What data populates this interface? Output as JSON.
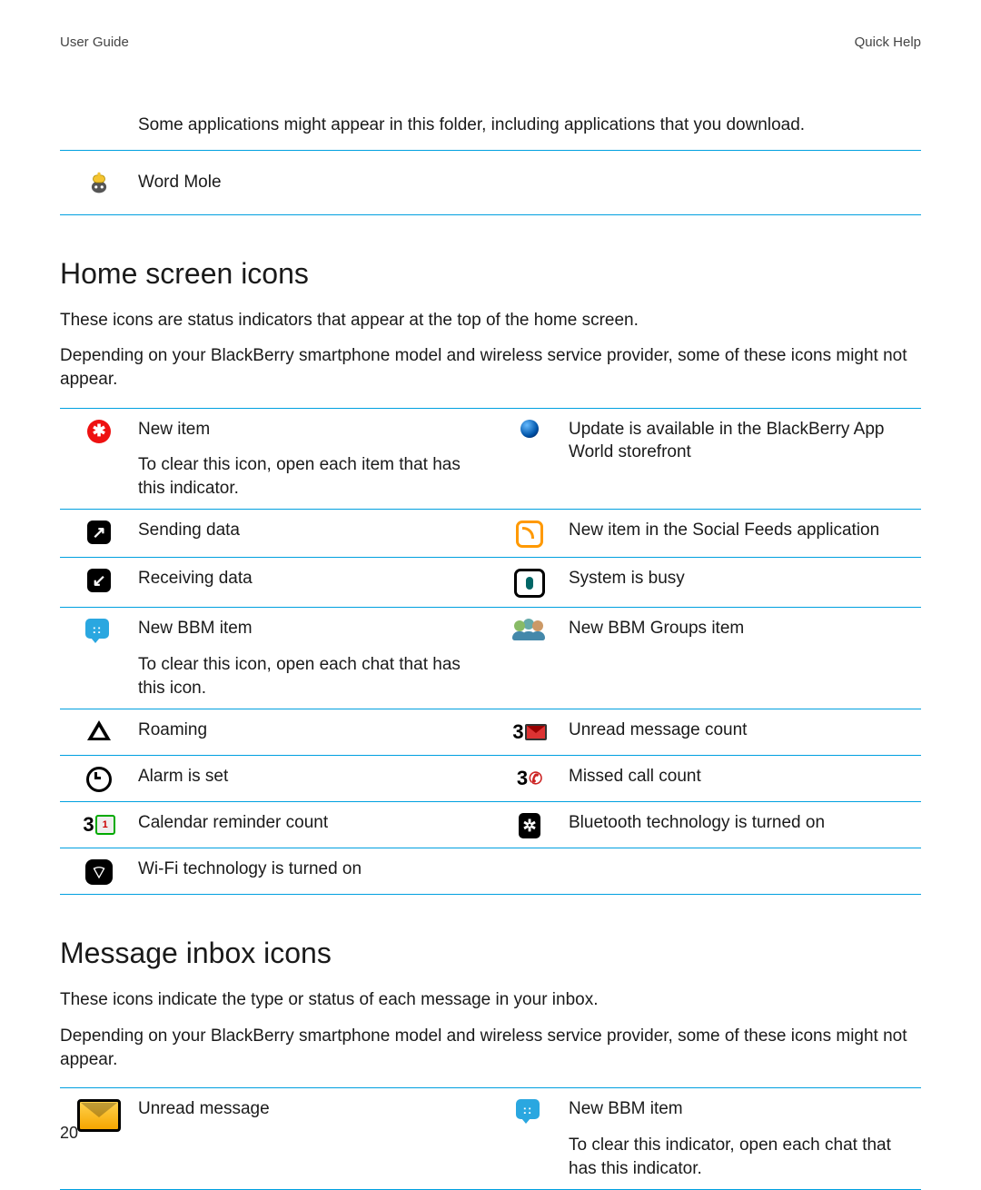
{
  "header": {
    "left": "User Guide",
    "right": "Quick Help"
  },
  "intro_note": "Some applications might appear in this folder, including applications that you download.",
  "word_mole": {
    "label": "Word Mole"
  },
  "home_section": {
    "heading": "Home screen icons",
    "p1": "These icons are status indicators that appear at the top of the home screen.",
    "p2": "Depending on your BlackBerry smartphone model and wireless service provider, some of these icons might not appear."
  },
  "hs_icons": {
    "new_item": {
      "label": "New item",
      "sub": "To clear this icon, open each item that has this indicator."
    },
    "app_world": {
      "label": "Update is available in the BlackBerry App World storefront"
    },
    "sending": {
      "label": "Sending data"
    },
    "social_feeds": {
      "label": "New item in the Social Feeds application"
    },
    "receiving": {
      "label": "Receiving data"
    },
    "busy": {
      "label": "System is busy"
    },
    "bbm": {
      "label": "New BBM item",
      "sub": "To clear this icon, open each chat that has this icon."
    },
    "bbm_groups": {
      "label": "New BBM Groups item"
    },
    "roaming": {
      "label": "Roaming"
    },
    "unread_count": {
      "label": "Unread message count",
      "count": "3"
    },
    "alarm": {
      "label": "Alarm is set"
    },
    "missed_call": {
      "label": "Missed call count",
      "count": "3"
    },
    "cal_count": {
      "label": "Calendar reminder count",
      "count": "3",
      "day": "1"
    },
    "bluetooth": {
      "label": "Bluetooth technology is turned on"
    },
    "wifi": {
      "label": "Wi-Fi technology is turned on"
    }
  },
  "inbox_section": {
    "heading": "Message inbox icons",
    "p1": "These icons indicate the type or status of each message in your inbox.",
    "p2": "Depending on your BlackBerry smartphone model and wireless service provider, some of these icons might not appear."
  },
  "inbox_icons": {
    "unread": {
      "label": "Unread message"
    },
    "bbm": {
      "label": "New BBM item",
      "sub": "To clear this indicator, open each chat that has this indicator."
    }
  },
  "page_number": "20"
}
